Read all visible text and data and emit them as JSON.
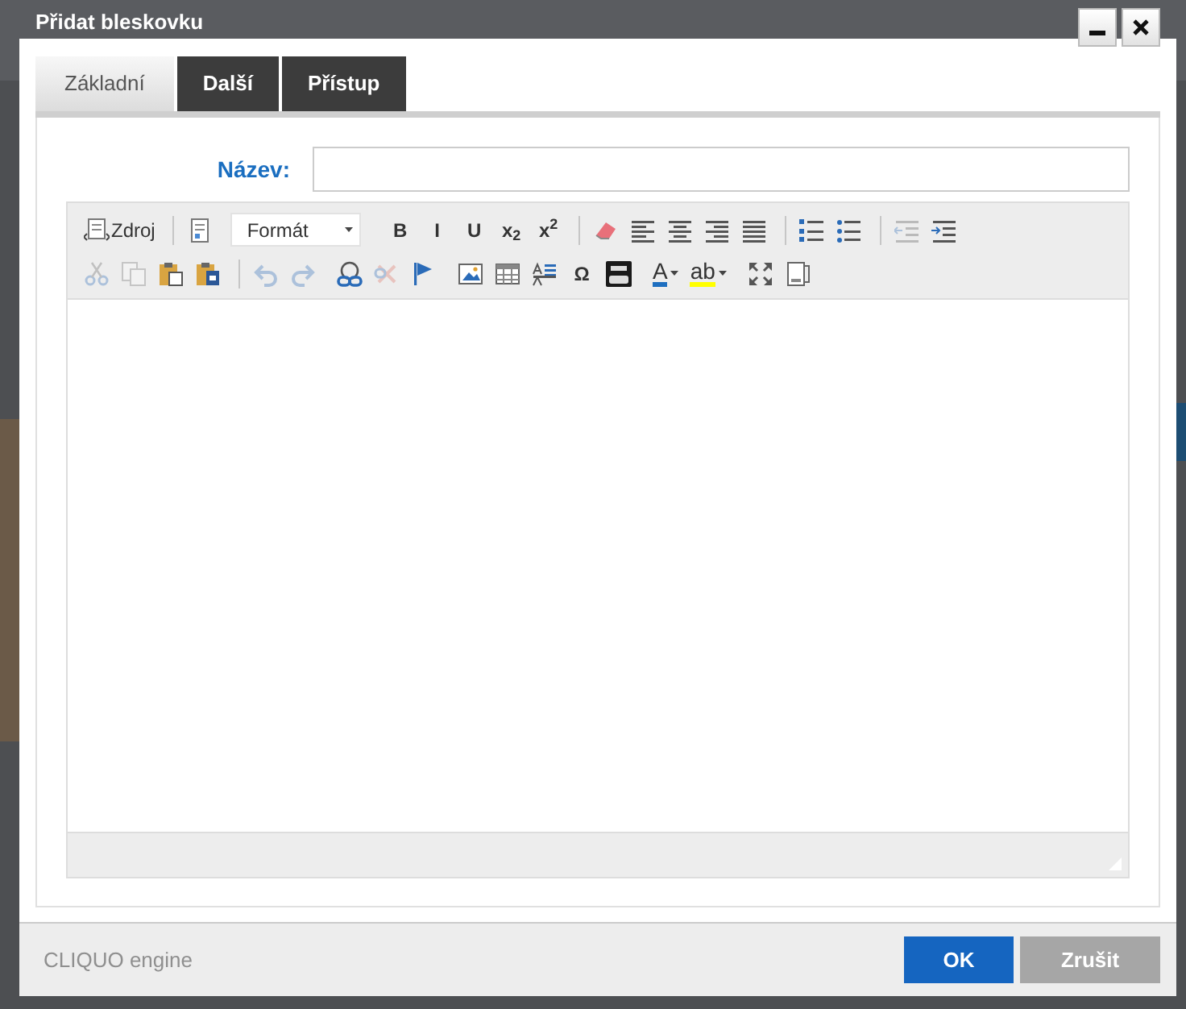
{
  "dialog": {
    "title": "Přidat bleskovku",
    "window_buttons": [
      {
        "kind": "minimize"
      },
      {
        "kind": "close"
      }
    ],
    "tabs": [
      {
        "label": "Základní",
        "selected": true
      },
      {
        "label": "Další",
        "selected": false
      },
      {
        "label": "Přístup",
        "selected": false
      }
    ],
    "fields": [
      {
        "label": "Název:"
      }
    ],
    "editor": {
      "toolbar_rows": [
        [
          {
            "divider": false,
            "items": [
              {
                "kind": "icontext",
                "label": "Zdroj",
                "disabled": false
              }
            ]
          },
          {
            "divider": true,
            "items": [
              {
                "kind": "icon",
                "disabled": false
              },
              {
                "kind": "combo",
                "label": "Formát",
                "disabled": false
              }
            ]
          },
          {
            "divider": false,
            "items": [
              {
                "kind": "text",
                "label": "B",
                "disabled": false
              },
              {
                "kind": "text",
                "label": "I",
                "disabled": false
              },
              {
                "kind": "text",
                "label": "U",
                "disabled": false
              },
              {
                "kind": "text",
                "label": "x$_{2}$",
                "disabled": false
              },
              {
                "kind": "text",
                "label": "x$^{2}$",
                "disabled": false
              }
            ]
          },
          {
            "divider": true,
            "items": [
              {
                "kind": "icon",
                "disabled": false
              },
              {
                "kind": "icon",
                "disabled": false
              },
              {
                "kind": "icon",
                "disabled": false
              },
              {
                "kind": "icon",
                "disabled": false
              },
              {
                "kind": "icon",
                "disabled": false
              }
            ]
          },
          {
            "divider": true,
            "items": [
              {
                "kind": "icon",
                "disabled": false
              },
              {
                "kind": "icon",
                "disabled": false
              }
            ]
          },
          {
            "divider": true,
            "items": [
              {
                "kind": "icon",
                "disabled": true
              },
              {
                "kind": "icon",
                "disabled": false
              }
            ]
          }
        ],
        [
          {
            "divider": false,
            "items": [
              {
                "kind": "icon",
                "disabled": true
              },
              {
                "kind": "icon",
                "disabled": true
              },
              {
                "kind": "icon",
                "disabled": false
              },
              {
                "kind": "icon",
                "disabled": false
              }
            ]
          },
          {
            "divider": true,
            "items": [
              {
                "kind": "icon",
                "disabled": true
              },
              {
                "kind": "icon",
                "disabled": true
              }
            ]
          },
          {
            "divider": false,
            "items": [
              {
                "kind": "icon",
                "disabled": false
              },
              {
                "kind": "icon",
                "disabled": true
              },
              {
                "kind": "icon",
                "disabled": false
              }
            ]
          },
          {
            "divider": false,
            "items": [
              {
                "kind": "icon",
                "disabled": false
              },
              {
                "kind": "icon",
                "disabled": false
              },
              {
                "kind": "icon",
                "disabled": false
              },
              {
                "kind": "text",
                "label": "Ω",
                "disabled": false
              },
              {
                "kind": "icon",
                "disabled": false
              }
            ]
          },
          {
            "divider": false,
            "items": [
              {
                "kind": "color",
                "label": "A",
                "color": "#1e6fc0",
                "disabled": false
              },
              {
                "kind": "color",
                "label": "ab",
                "color": "#ffff00",
                "disabled": false
              }
            ]
          },
          {
            "divider": false,
            "items": [
              {
                "kind": "icon",
                "disabled": false
              },
              {
                "kind": "icon",
                "disabled": false
              }
            ]
          }
        ]
      ]
    },
    "footer": {
      "brand": "CLIQUO engine",
      "buttons": [
        {
          "label": "OK",
          "kind": "primary"
        },
        {
          "label": "Zrušit",
          "kind": "secondary"
        }
      ]
    }
  }
}
